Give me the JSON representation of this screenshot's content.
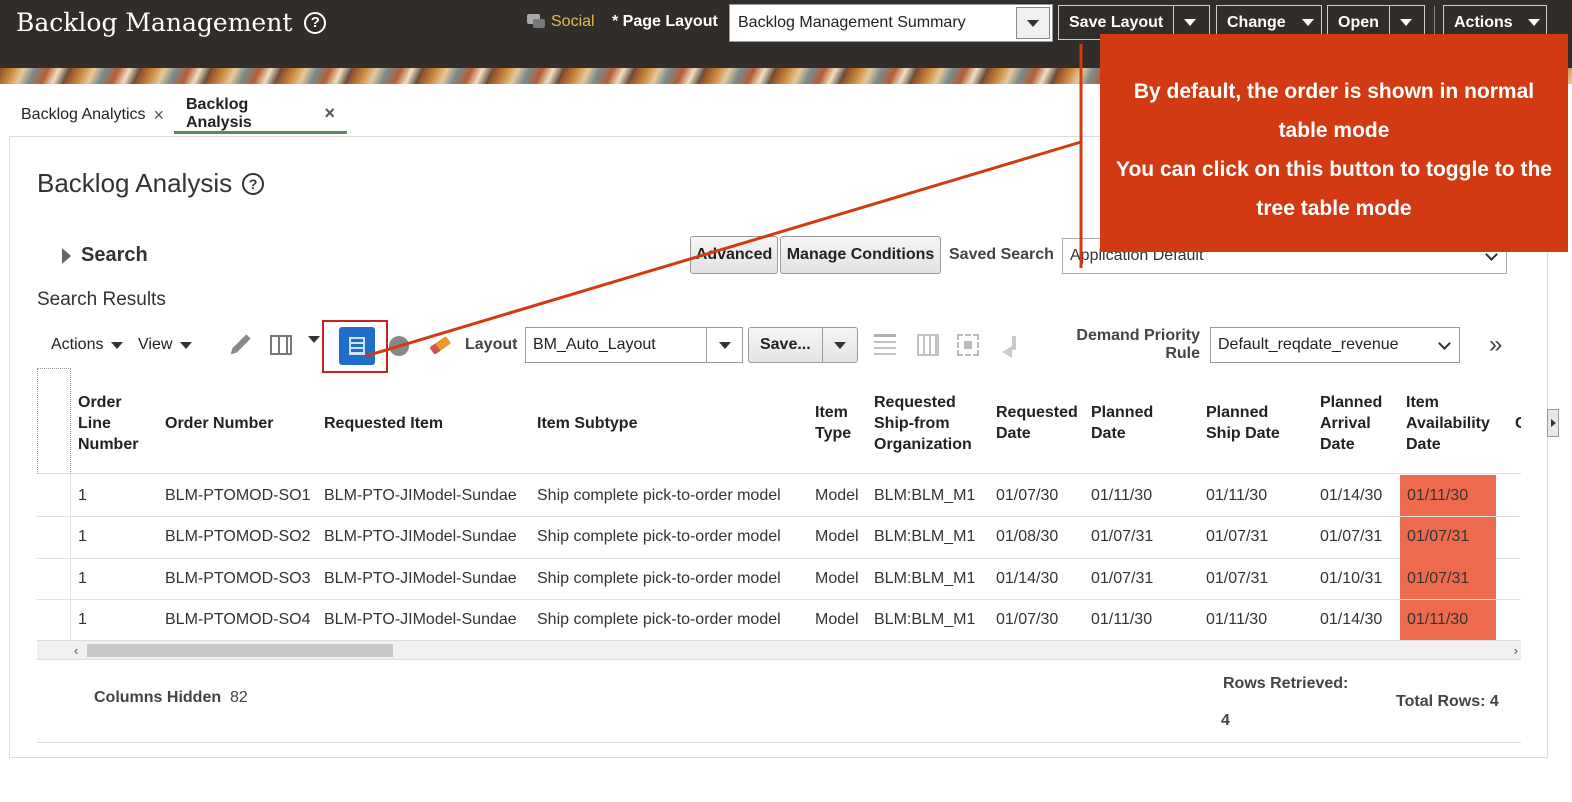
{
  "header": {
    "app_title": "Backlog Management",
    "social_label": "Social",
    "page_layout_label": "* Page Layout",
    "page_layout_value": "Backlog Management Summary",
    "buttons": {
      "save_layout": "Save Layout",
      "change": "Change",
      "open": "Open",
      "actions": "Actions"
    }
  },
  "tabs": [
    {
      "label": "Backlog Analytics",
      "active": false
    },
    {
      "label": "Backlog Analysis",
      "active": true
    }
  ],
  "page": {
    "title": "Backlog Analysis",
    "search_label": "Search",
    "advanced_label": "Advanced",
    "manage_conditions_label": "Manage Conditions",
    "saved_search_label": "Saved Search",
    "saved_search_value": "Application Default",
    "results_title": "Search Results"
  },
  "toolbar": {
    "actions_menu": "Actions",
    "view_menu": "View",
    "layout_label": "Layout",
    "layout_value": "BM_Auto_Layout",
    "save_label": "Save...",
    "demand_priority_label": "Demand Priority Rule",
    "demand_priority_value": "Default_reqdate_revenue"
  },
  "table": {
    "columns": [
      "Order Line Number",
      "Order Number",
      "Requested Item",
      "Item Subtype",
      "Item Type",
      "Requested Ship-from Organization",
      "Requested Date",
      "Planned Date",
      "Planned Ship Date",
      "Planned Arrival Date",
      "Item Availability Date",
      "C"
    ],
    "rows": [
      [
        "1",
        "BLM-PTOMOD-SO1",
        "BLM-PTO-JIModel-Sundae",
        "Ship complete pick-to-order model",
        "Model",
        "BLM:BLM_M1",
        "01/07/30",
        "01/11/30",
        "01/11/30",
        "01/14/30",
        "01/11/30"
      ],
      [
        "1",
        "BLM-PTOMOD-SO2",
        "BLM-PTO-JIModel-Sundae",
        "Ship complete pick-to-order model",
        "Model",
        "BLM:BLM_M1",
        "01/08/30",
        "01/07/31",
        "01/07/31",
        "01/07/31",
        "01/07/31"
      ],
      [
        "1",
        "BLM-PTOMOD-SO3",
        "BLM-PTO-JIModel-Sundae",
        "Ship complete pick-to-order model",
        "Model",
        "BLM:BLM_M1",
        "01/14/30",
        "01/07/31",
        "01/07/31",
        "01/10/31",
        "01/07/31"
      ],
      [
        "1",
        "BLM-PTOMOD-SO4",
        "BLM-PTO-JIModel-Sundae",
        "Ship complete pick-to-order model",
        "Model",
        "BLM:BLM_M1",
        "01/07/30",
        "01/11/30",
        "01/11/30",
        "01/14/30",
        "01/11/30"
      ]
    ],
    "alert_color": "#ee6a4f"
  },
  "footer": {
    "columns_hidden_label": "Columns Hidden",
    "columns_hidden_value": "82",
    "rows_retrieved_label": "Rows Retrieved:",
    "rows_retrieved_value": "4",
    "total_rows": "Total Rows: 4"
  },
  "callout": {
    "lines": [
      "By default, the order is shown in normal",
      "table mode",
      "You can click on this button to toggle to the",
      "tree table mode"
    ],
    "color": "#d13a13"
  },
  "icons": [
    "help-icon",
    "social-icon",
    "edit-icon",
    "table-columns-icon",
    "tree-table-toggle-icon",
    "clear-icon",
    "query-by-example-icon",
    "freeze-icon",
    "detach-icon",
    "wrap-icon",
    "expand-more-icon"
  ]
}
